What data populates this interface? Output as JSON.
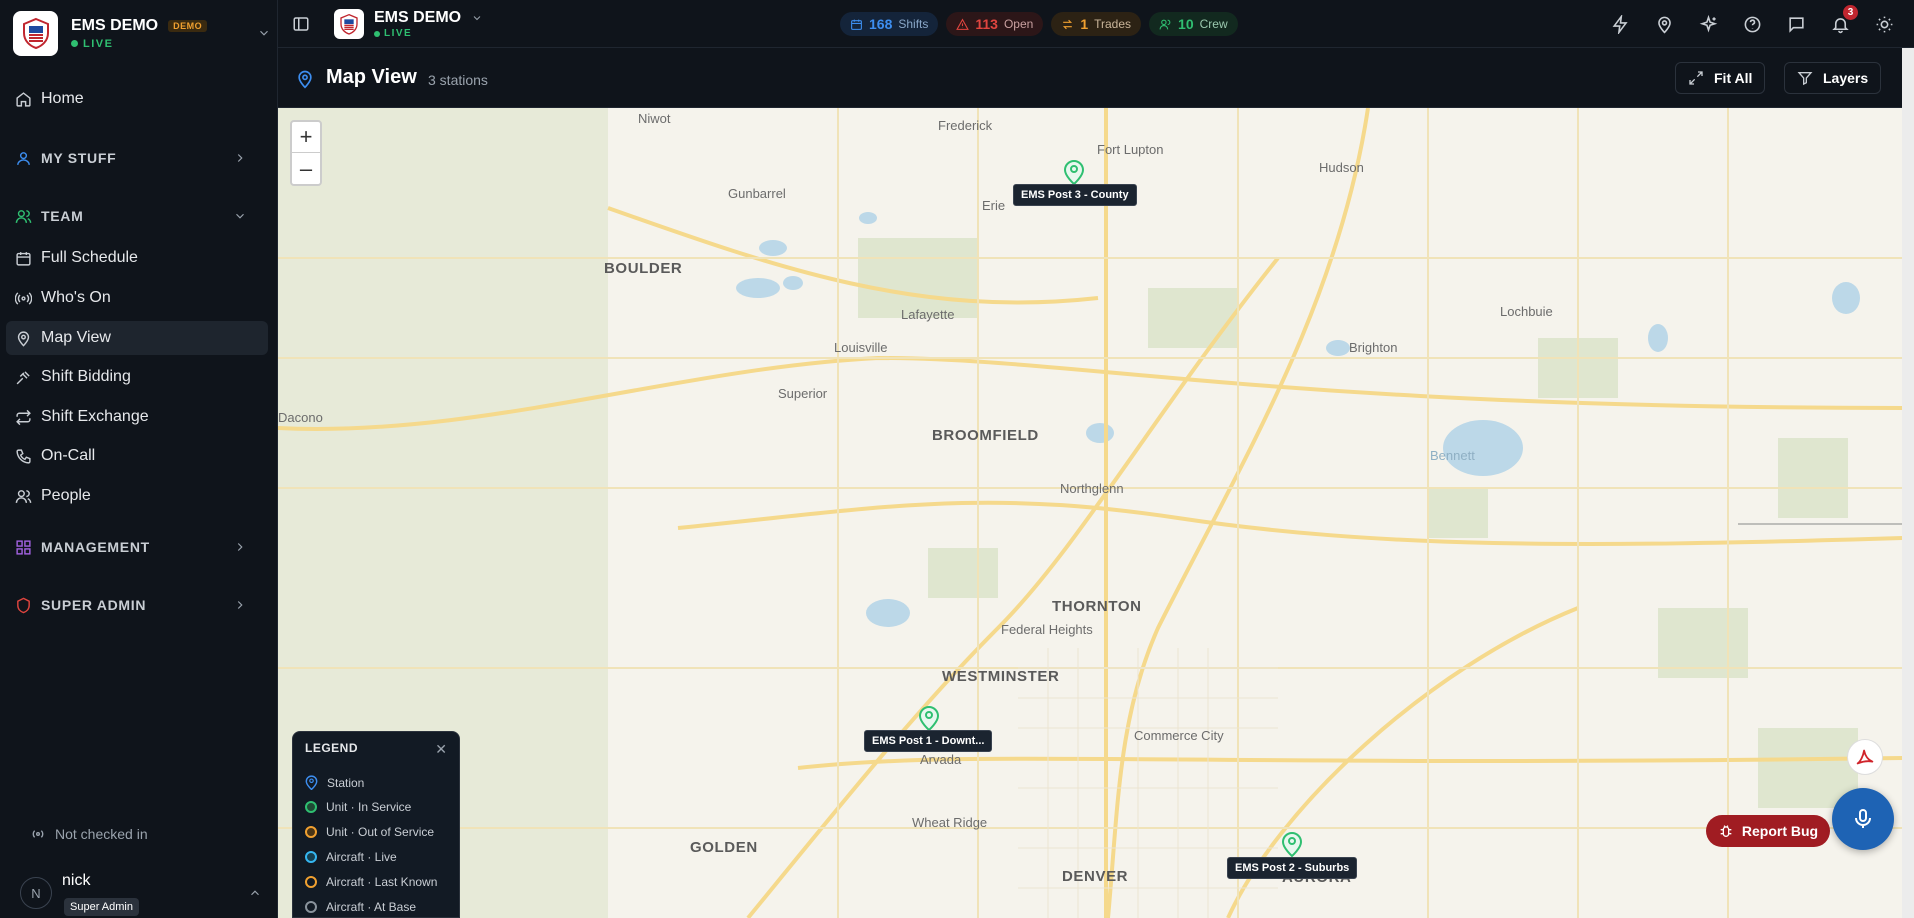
{
  "sidebar": {
    "brand": {
      "title": "EMS DEMO",
      "badge": "DEMO",
      "status": "LIVE"
    },
    "home": "Home",
    "my_stuff": "MY STUFF",
    "team": "TEAM",
    "team_items": [
      "Full Schedule",
      "Who's On",
      "Map View",
      "Shift Bidding",
      "Shift Exchange",
      "On-Call",
      "People"
    ],
    "management": "MANAGEMENT",
    "super_admin": "SUPER ADMIN",
    "checkin_status": "Not checked in",
    "user": {
      "initial": "N",
      "name": "nick",
      "role": "Super Admin"
    }
  },
  "topbar": {
    "org_name": "EMS DEMO",
    "org_status": "LIVE",
    "stats": [
      {
        "value": "168",
        "label": "Shifts",
        "color": "#3d8ef0"
      },
      {
        "value": "113",
        "label": "Open",
        "color": "#e0453f"
      },
      {
        "value": "1",
        "label": "Trades",
        "color": "#f0a030"
      },
      {
        "value": "10",
        "label": "Crew",
        "color": "#2fbf71"
      }
    ],
    "notification_count": "3"
  },
  "page": {
    "title": "Map View",
    "count": "3 stations",
    "fit_all": "Fit All",
    "layers": "Layers"
  },
  "map": {
    "zoom_in": "+",
    "zoom_out": "–",
    "places": [
      "Niwot",
      "Frederick",
      "Fort Lupton",
      "Hudson",
      "Gunbarrel",
      "Erie",
      "BOULDER",
      "Lochbuie",
      "Lafayette",
      "Brighton",
      "Louisville",
      "Superior",
      "BROOMFIELD",
      "Northglenn",
      "THORNTON",
      "Federal Heights",
      "WESTMINSTER",
      "Commerce City",
      "Arvada",
      "Wheat Ridge",
      "GOLDEN",
      "DENVER",
      "AURORA",
      "Bennett",
      "Dacono"
    ],
    "stations": [
      {
        "name": "EMS Post 3 - County"
      },
      {
        "name": "EMS Post 1 - Downt..."
      },
      {
        "name": "EMS Post 2 - Suburbs"
      }
    ]
  },
  "legend": {
    "title": "LEGEND",
    "items": [
      {
        "label": "Station",
        "color": "#3d8ef0"
      },
      {
        "label": "Unit · In Service",
        "color": "#2fbf71"
      },
      {
        "label": "Unit · Out of Service",
        "color": "#f0a030"
      },
      {
        "label": "Aircraft · Live",
        "color": "#35b6f0"
      },
      {
        "label": "Aircraft · Last Known",
        "color": "#f0a030"
      },
      {
        "label": "Aircraft · At Base",
        "color": "#8a939c"
      }
    ]
  },
  "report_bug": "Report Bug"
}
